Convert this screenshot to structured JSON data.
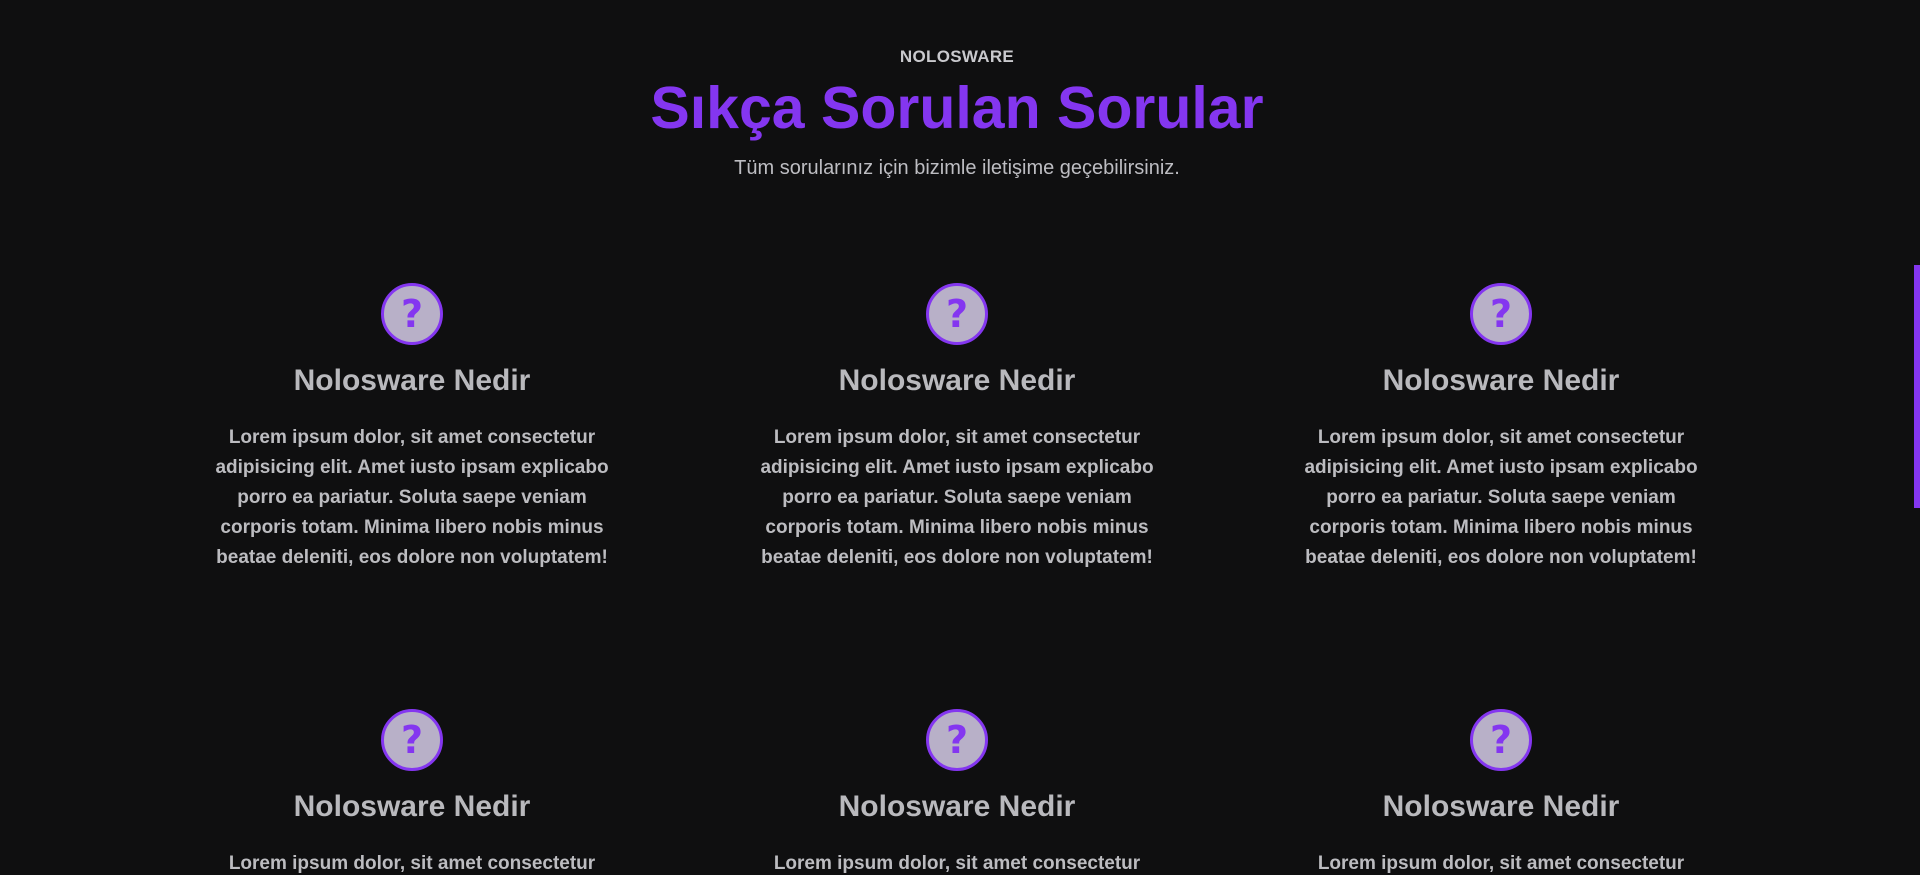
{
  "section": {
    "eyebrow": "NOLOSWARE",
    "title": "Sıkça Sorulan Sorular",
    "subtitle": "Tüm sorularınız için bizimle iletişime geçebilirsiniz."
  },
  "faq": {
    "items": [
      {
        "icon": "question-circle-icon",
        "title": "Nolosware Nedir",
        "text": "Lorem ipsum dolor, sit amet consectetur adipisicing elit. Amet iusto ipsam explicabo porro ea pariatur. Soluta saepe veniam corporis totam. Minima libero nobis minus beatae deleniti, eos dolore non voluptatem!"
      },
      {
        "icon": "question-circle-icon",
        "title": "Nolosware Nedir",
        "text": "Lorem ipsum dolor, sit amet consectetur adipisicing elit. Amet iusto ipsam explicabo porro ea pariatur. Soluta saepe veniam corporis totam. Minima libero nobis minus beatae deleniti, eos dolore non voluptatem!"
      },
      {
        "icon": "question-circle-icon",
        "title": "Nolosware Nedir",
        "text": "Lorem ipsum dolor, sit amet consectetur adipisicing elit. Amet iusto ipsam explicabo porro ea pariatur. Soluta saepe veniam corporis totam. Minima libero nobis minus beatae deleniti, eos dolore non voluptatem!"
      },
      {
        "icon": "question-circle-icon",
        "title": "Nolosware Nedir",
        "text": "Lorem ipsum dolor, sit amet consectetur"
      },
      {
        "icon": "question-circle-icon",
        "title": "Nolosware Nedir",
        "text": "Lorem ipsum dolor, sit amet consectetur"
      },
      {
        "icon": "question-circle-icon",
        "title": "Nolosware Nedir",
        "text": "Lorem ipsum dolor, sit amet consectetur"
      }
    ]
  },
  "colors": {
    "background": "#0f0f10",
    "accent": "#8436f0",
    "text": "#bcbcc0",
    "icon_fill": "#b8b0c8"
  },
  "icon_glyph": "?"
}
